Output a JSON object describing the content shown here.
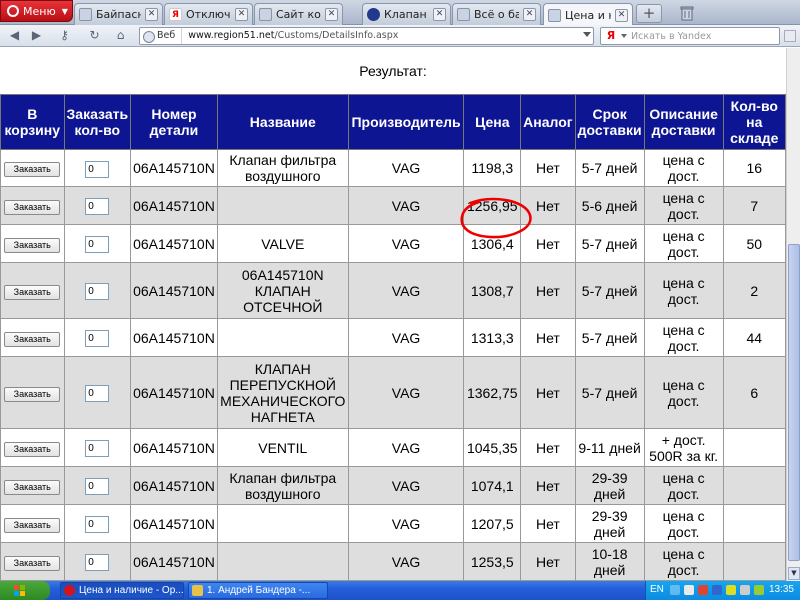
{
  "browser": {
    "menu_label": "Меню",
    "tabs": [
      {
        "title": "Байпасный...",
        "favicon": "page-icon",
        "active": false
      },
      {
        "title": "Отключаю...",
        "favicon": "yandex-icon",
        "active": false
      },
      {
        "title": "Сайт комп...",
        "favicon": "page-icon",
        "active": false
      },
      {
        "title": "Клапан сис...",
        "favicon": "mazda-icon",
        "active": false
      },
      {
        "title": "Всё о байп...",
        "favicon": "page-icon",
        "active": false
      },
      {
        "title": "Цена и нал...",
        "favicon": "page-icon",
        "active": true
      }
    ],
    "web_label": "Веб",
    "url_host": "www.region51.net",
    "url_path": "/Customs/DetailsInfo.aspx",
    "search_placeholder": "Искать в Yandex"
  },
  "page": {
    "result_label": "Результат:",
    "headers": [
      "В корзину",
      "Заказать кол-во",
      "Номер детали",
      "Название",
      "Производитель",
      "Цена",
      "Аналог",
      "Срок доставки",
      "Описание доставки",
      "Кол-во на складе"
    ],
    "order_label": "Заказать",
    "rows": [
      {
        "qty": "0",
        "part": "06A145710N",
        "name": "Клапан фильтра воздушного",
        "maker": "VAG",
        "price": "1198,3",
        "analog": "Нет",
        "term": "5-7 дней",
        "desc": "цена с дост.",
        "stock": "16"
      },
      {
        "qty": "0",
        "part": "06A145710N",
        "name": "",
        "maker": "VAG",
        "price": "1256,95",
        "analog": "Нет",
        "term": "5-6 дней",
        "desc": "цена с дост.",
        "stock": "7"
      },
      {
        "qty": "0",
        "part": "06A145710N",
        "name": "VALVE",
        "maker": "VAG",
        "price": "1306,4",
        "analog": "Нет",
        "term": "5-7 дней",
        "desc": "цена с дост.",
        "stock": "50"
      },
      {
        "qty": "0",
        "part": "06A145710N",
        "name": "06A145710N КЛАПАН ОТСЕЧНОЙ",
        "maker": "VAG",
        "price": "1308,7",
        "analog": "Нет",
        "term": "5-7 дней",
        "desc": "цена с дост.",
        "stock": "2"
      },
      {
        "qty": "0",
        "part": "06A145710N",
        "name": "",
        "maker": "VAG",
        "price": "1313,3",
        "analog": "Нет",
        "term": "5-7 дней",
        "desc": "цена с дост.",
        "stock": "44"
      },
      {
        "qty": "0",
        "part": "06A145710N",
        "name": "КЛАПАН ПЕРЕПУСКНОЙ МЕХАНИЧЕСКОГО НАГНЕТА",
        "maker": "VAG",
        "price": "1362,75",
        "analog": "Нет",
        "term": "5-7 дней",
        "desc": "цена с дост.",
        "stock": "6"
      },
      {
        "qty": "0",
        "part": "06A145710N",
        "name": "VENTIL",
        "maker": "VAG",
        "price": "1045,35",
        "analog": "Нет",
        "term": "9-11 дней",
        "desc": "+ дост. 500R за кг.",
        "stock": ""
      },
      {
        "qty": "0",
        "part": "06A145710N",
        "name": "Клапан фильтра воздушного",
        "maker": "VAG",
        "price": "1074,1",
        "analog": "Нет",
        "term": "29-39 дней",
        "desc": "цена с дост.",
        "stock": ""
      },
      {
        "qty": "0",
        "part": "06A145710N",
        "name": "",
        "maker": "VAG",
        "price": "1207,5",
        "analog": "Нет",
        "term": "29-39 дней",
        "desc": "цена с дост.",
        "stock": ""
      },
      {
        "qty": "0",
        "part": "06A145710N",
        "name": "",
        "maker": "VAG",
        "price": "1253,5",
        "analog": "Нет",
        "term": "10-18 дней",
        "desc": "цена с дост.",
        "stock": ""
      }
    ]
  },
  "taskbar": {
    "items": [
      {
        "label": "Цена и наличие - Ор...",
        "active": true
      },
      {
        "label": "1. Андрей Бандера -...",
        "active": false
      }
    ],
    "lang": "EN",
    "clock": "13:35"
  },
  "colors": {
    "header_bg": "#0e1593",
    "row_alt": "#dedede",
    "highlight_ring": "#ee0000",
    "opera_red": "#d0161d"
  }
}
